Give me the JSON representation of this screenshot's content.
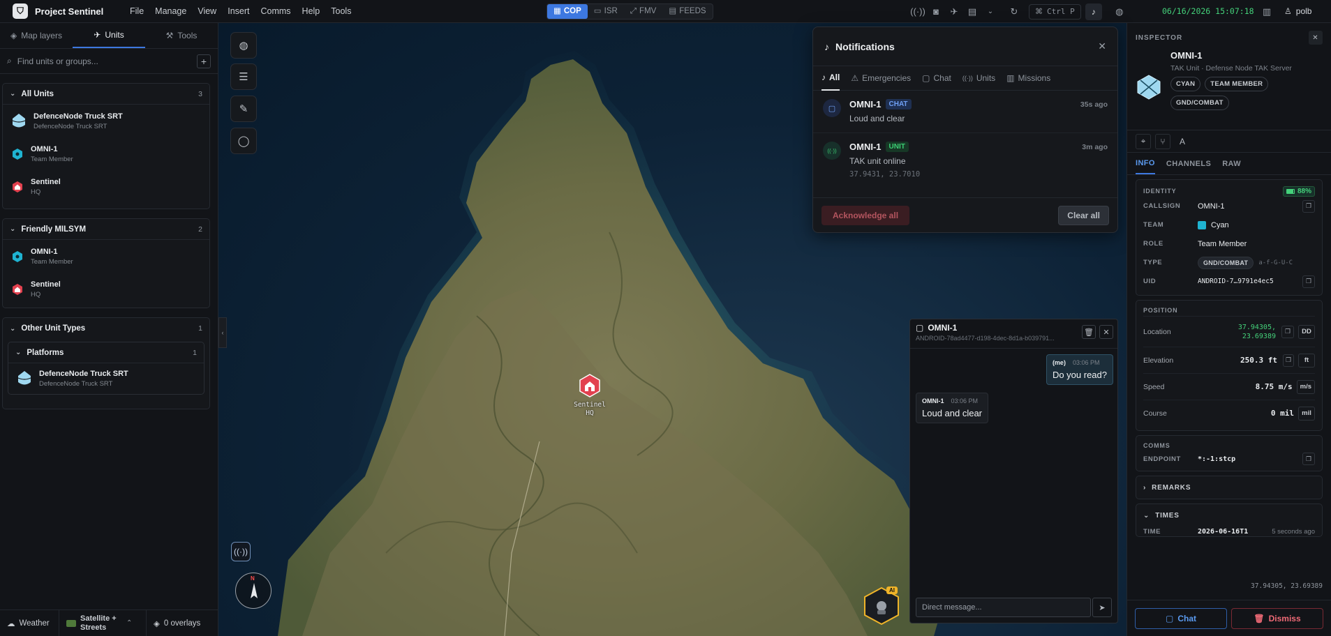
{
  "app": {
    "title": "Project Sentinel",
    "logo_glyph": "⛉"
  },
  "menu": [
    "File",
    "Manage",
    "View",
    "Insert",
    "Comms",
    "Help",
    "Tools"
  ],
  "modes": [
    {
      "label": "COP",
      "icon": "map-icon",
      "glyph": "▦",
      "active": true
    },
    {
      "label": "ISR",
      "icon": "monitor-icon",
      "glyph": "▭",
      "active": false
    },
    {
      "label": "FMV",
      "icon": "expand-icon",
      "glyph": "⤢",
      "active": false
    },
    {
      "label": "FEEDS",
      "icon": "grid-icon",
      "glyph": "▤",
      "active": false
    }
  ],
  "toolbar": {
    "shortcut_label": "Ctrl P",
    "datetime": "06/16/2026 15:07:18",
    "user": "polb"
  },
  "left_panel": {
    "tabs": [
      {
        "label": "Map layers",
        "icon": "layers-icon",
        "glyph": "◈",
        "active": false
      },
      {
        "label": "Units",
        "icon": "drone-icon",
        "glyph": "✈",
        "active": true
      },
      {
        "label": "Tools",
        "icon": "wrench-icon",
        "glyph": "⚒",
        "active": false
      }
    ],
    "search_placeholder": "Find units or groups...",
    "groups": {
      "all_units": {
        "title": "All Units",
        "count": "3",
        "units": [
          {
            "name": "DefenceNode Truck SRT",
            "sub": "DefenceNode Truck SRT",
            "kind": "platform"
          },
          {
            "name": "OMNI-1",
            "sub": "Team Member",
            "kind": "friendly"
          },
          {
            "name": "Sentinel",
            "sub": "HQ",
            "kind": "hq"
          }
        ]
      },
      "friendly": {
        "title": "Friendly MILSYM",
        "count": "2",
        "units": [
          {
            "name": "OMNI-1",
            "sub": "Team Member",
            "kind": "friendly"
          },
          {
            "name": "Sentinel",
            "sub": "HQ",
            "kind": "hq"
          }
        ]
      },
      "other": {
        "title": "Other Unit Types",
        "count": "1",
        "subgroup": {
          "title": "Platforms",
          "count": "1",
          "units": [
            {
              "name": "DefenceNode Truck SRT",
              "sub": "DefenceNode Truck SRT",
              "kind": "platform"
            }
          ]
        }
      }
    },
    "bottom": {
      "weather": "Weather",
      "basemap": "Satellite + Streets",
      "overlays": "0 overlays"
    }
  },
  "map": {
    "marker_label_1": "Sentinel",
    "marker_label_2": "HQ",
    "compass_label": "N",
    "ai_badge": "AI"
  },
  "notifications": {
    "title": "Notifications",
    "tabs": [
      {
        "label": "All",
        "icon": "bell-icon",
        "glyph": "♪",
        "active": true
      },
      {
        "label": "Emergencies",
        "icon": "warning-icon",
        "glyph": "⚠",
        "active": false
      },
      {
        "label": "Chat",
        "icon": "chat-icon",
        "glyph": "▢",
        "active": false
      },
      {
        "label": "Units",
        "icon": "signal-icon",
        "glyph": "((·))",
        "active": false
      },
      {
        "label": "Missions",
        "icon": "book-icon",
        "glyph": "▥",
        "active": false
      }
    ],
    "items": [
      {
        "from": "OMNI-1",
        "badge": "CHAT",
        "time": "35s ago",
        "message": "Loud and clear",
        "coords": ""
      },
      {
        "from": "OMNI-1",
        "badge": "UNIT",
        "time": "3m ago",
        "message": "TAK unit online",
        "coords": "37.9431, 23.7010"
      }
    ],
    "acknowledge_label": "Acknowledge all",
    "clear_label": "Clear all"
  },
  "chat": {
    "title": "OMNI-1",
    "uid": "ANDROID-78ad4477-d198-4dec-8d1a-b039791...",
    "messages": [
      {
        "sender": "(me)",
        "time": "03:06 PM",
        "text": "Do you read?"
      },
      {
        "sender": "OMNI-1",
        "time": "03:06 PM",
        "text": "Loud and clear"
      }
    ],
    "input_placeholder": "Direct message..."
  },
  "inspector": {
    "header": "INSPECTOR",
    "unit_name": "OMNI-1",
    "unit_desc": "TAK Unit · Defense Node TAK Server",
    "chips": [
      "CYAN",
      "TEAM MEMBER",
      "GND/COMBAT"
    ],
    "tabs": [
      {
        "label": "INFO",
        "active": true
      },
      {
        "label": "CHANNELS",
        "active": false
      },
      {
        "label": "RAW",
        "active": false
      }
    ],
    "identity": {
      "title": "IDENTITY",
      "battery": "88%",
      "battery_level": 0.88,
      "callsign_key": "CALLSIGN",
      "callsign": "OMNI-1",
      "team_key": "TEAM",
      "team": "Cyan",
      "team_color": "#1fb3d1",
      "role_key": "ROLE",
      "role": "Team Member",
      "type_key": "TYPE",
      "type": "GND/COMBAT",
      "type_code": "a-f-G-U-C",
      "uid_key": "UID",
      "uid": "ANDROID-7…9791e4ec5"
    },
    "position": {
      "title": "POSITION",
      "location_key": "Location",
      "lat": "37.94305,",
      "lon": "23.69389",
      "location_fmt": "DD",
      "elevation_key": "Elevation",
      "elevation": "250.3 ft",
      "elevation_unit": "ft",
      "speed_key": "Speed",
      "speed": "8.75 m/s",
      "speed_unit": "m/s",
      "course_key": "Course",
      "course": "0 mil",
      "course_unit": "mil"
    },
    "comms": {
      "title": "COMMS",
      "endpoint_key": "ENDPOINT",
      "endpoint": "*:-1:stcp"
    },
    "remarks_label": "REMARKS",
    "times": {
      "title": "TIMES",
      "time_key": "TIME",
      "time": "2026-06-16T1",
      "ago": "5 seconds ago"
    },
    "footer_coords": "37.94305, 23.69389",
    "chat_label": "Chat",
    "dismiss_label": "Dismiss"
  },
  "colors": {
    "accent": "#3d78e0",
    "friendly": "#1fb3d1",
    "hq": "#e2414f",
    "chat_badge": "#4a8cf0",
    "unit_badge": "#3ccf74",
    "status_green": "#44d17a"
  }
}
